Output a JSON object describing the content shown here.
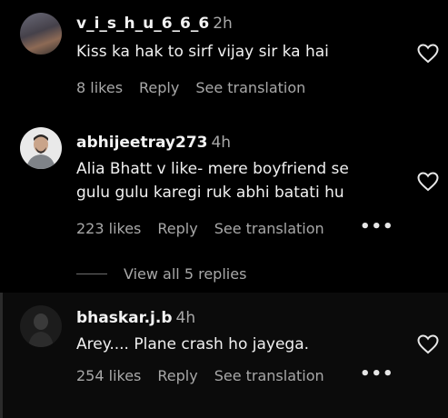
{
  "comments": [
    {
      "username": "v_i_s_h_u_6_6_6",
      "time": "2h",
      "text_lines": [
        "Kiss ka hak to sirf vijay sir ka hai"
      ],
      "likes": "8 likes",
      "reply": "Reply",
      "translate": "See translation"
    },
    {
      "username": "abhijeetray273",
      "time": "4h",
      "text_lines": [
        "Alia Bhatt v like- mere boyfriend se",
        "gulu gulu karegi ruk abhi batati hu"
      ],
      "likes": "223 likes",
      "reply": "Reply",
      "translate": "See translation",
      "more": "•••",
      "view_replies": "View all 5 replies"
    },
    {
      "username": "bhaskar.j.b",
      "time": "4h",
      "text_lines": [
        "Arey.... Plane crash ho jayega."
      ],
      "likes": "254 likes",
      "reply": "Reply",
      "translate": "See translation",
      "more": "•••"
    }
  ],
  "icons": {
    "like": "heart-outline-icon",
    "more": "more-dots-icon"
  },
  "colors": {
    "background": "#000000",
    "muted": "#a8a8a8",
    "text": "#f5f5f5"
  }
}
